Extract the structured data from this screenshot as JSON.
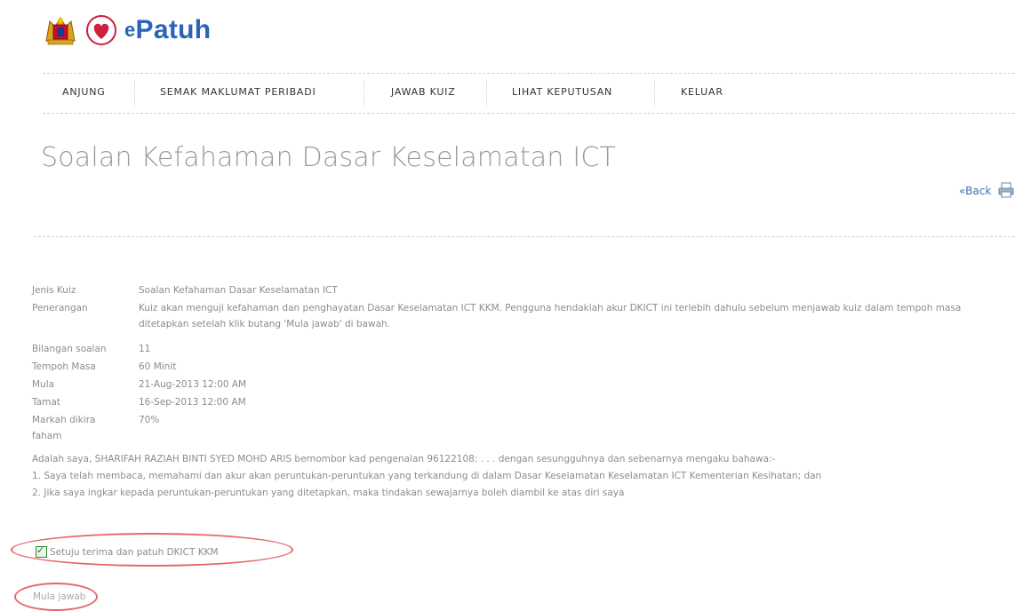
{
  "brand": {
    "name_prefix": "e",
    "name": "Patuh",
    "accent_color": "#2a63b8",
    "logos": [
      "malaysia-crest-icon",
      "heart-icon"
    ]
  },
  "nav": {
    "items": [
      {
        "label": "ANJUNG"
      },
      {
        "label": "SEMAK MAKLUMAT PERIBADI"
      },
      {
        "label": "JAWAB KUIZ"
      },
      {
        "label": "LIHAT KEPUTUSAN"
      },
      {
        "label": "KELUAR"
      }
    ]
  },
  "page": {
    "title": "Soalan Kefahaman Dasar Keselamatan ICT",
    "back_label": "«Back",
    "print_icon": "printer-icon"
  },
  "details": [
    {
      "label": "Jenis Kuiz",
      "value": "Soalan Kefahaman Dasar Keselamatan ICT"
    },
    {
      "label": "Penerangan",
      "value": "Kuiz akan menguji kefahaman dan penghayatan Dasar Keselamatan ICT KKM. Pengguna hendaklah akur DKICT ini terlebih dahulu sebelum menjawab kuiz dalam tempoh masa ditetapkan setelah klik butang 'Mula jawab' di bawah."
    },
    {
      "label": "Bilangan soalan",
      "value": "11"
    },
    {
      "label": "Tempoh Masa",
      "value": "60 Minit"
    },
    {
      "label": "Mula",
      "value": "21-Aug-2013 12:00 AM"
    },
    {
      "label": "Tamat",
      "value": "16-Sep-2013 12:00 AM"
    },
    {
      "label": "Markah dikira faham",
      "value": "70%"
    }
  ],
  "declaration": {
    "intro": "Adalah saya, SHARIFAH RAZIAH BINTI SYED MOHD ARIS bernombor kad pengenalan 96122108: . . . dengan sesungguhnya dan sebenarnya mengaku bahawa:-",
    "point1": "1. Saya telah membaca, memahami dan akur akan peruntukan-peruntukan yang terkandung di dalam Dasar Keselamatan Keselamatan ICT Kementerian Kesihatan; dan",
    "point2": "2. Jika saya ingkar kepada peruntukan-peruntukan yang ditetapkan, maka tindakan sewajarnya boleh diambil ke atas diri saya"
  },
  "agree": {
    "label": "Setuju terima dan patuh DKICT KKM",
    "checked": true
  },
  "start_button": {
    "label": "Mula jawab"
  },
  "colors": {
    "annotation_red": "#e36a6a",
    "link_blue": "#3d6fb6"
  }
}
